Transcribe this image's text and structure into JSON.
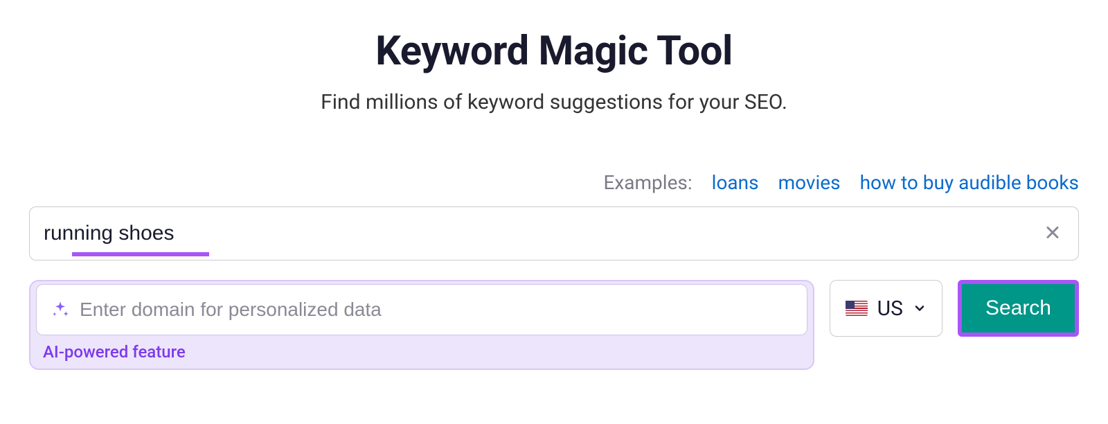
{
  "header": {
    "title": "Keyword Magic Tool",
    "subtitle": "Find millions of keyword suggestions for your SEO."
  },
  "examples": {
    "label": "Examples:",
    "items": [
      "loans",
      "movies",
      "how to buy audible books"
    ]
  },
  "keyword_input": {
    "value": "running shoes"
  },
  "domain_input": {
    "placeholder": "Enter domain for personalized data",
    "caption": "AI-powered feature"
  },
  "country": {
    "code": "US"
  },
  "search": {
    "label": "Search"
  }
}
